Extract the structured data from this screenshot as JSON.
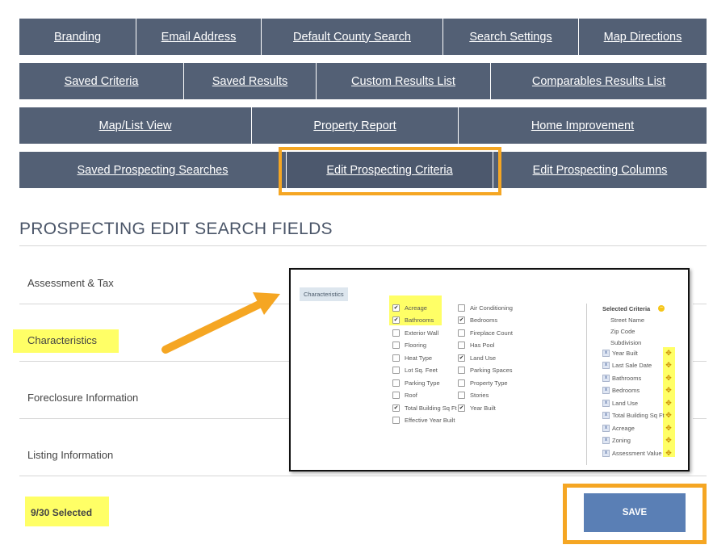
{
  "nav": {
    "row1": [
      "Branding",
      "Email Address",
      "Default County Search",
      "Search Settings",
      "Map Directions"
    ],
    "row2": [
      "Saved Criteria",
      "Saved Results",
      "Custom Results List",
      "Comparables Results List"
    ],
    "row3": [
      "Map/List View",
      "Property Report",
      "Home Improvement"
    ],
    "row4": [
      "Saved Prospecting Searches",
      "Edit Prospecting Criteria",
      "Edit Prospecting Columns"
    ]
  },
  "heading": "PROSPECTING EDIT SEARCH FIELDS",
  "categories": [
    "Assessment & Tax",
    "Characteristics",
    "Foreclosure Information",
    "Listing Information"
  ],
  "selected_count": "9/30 Selected",
  "save_label": "SAVE",
  "inset": {
    "tag": "Characteristics",
    "left_col": [
      {
        "label": "Acreage",
        "checked": true
      },
      {
        "label": "Bathrooms",
        "checked": true
      },
      {
        "label": "Exterior Wall",
        "checked": false
      },
      {
        "label": "Flooring",
        "checked": false
      },
      {
        "label": "Heat Type",
        "checked": false
      },
      {
        "label": "Lot Sq. Feet",
        "checked": false
      },
      {
        "label": "Parking Type",
        "checked": false
      },
      {
        "label": "Roof",
        "checked": false
      },
      {
        "label": "Total Building Sq Ft",
        "checked": true
      },
      {
        "label": "Effective Year Built",
        "checked": false
      }
    ],
    "right_col": [
      {
        "label": "Air Conditioning",
        "checked": false
      },
      {
        "label": "Bedrooms",
        "checked": true
      },
      {
        "label": "Fireplace Count",
        "checked": false
      },
      {
        "label": "Has Pool",
        "checked": false
      },
      {
        "label": "Land Use",
        "checked": true
      },
      {
        "label": "Parking Spaces",
        "checked": false
      },
      {
        "label": "Property Type",
        "checked": false
      },
      {
        "label": "Stories",
        "checked": false
      },
      {
        "label": "Year Built",
        "checked": true
      }
    ],
    "selected_title": "Selected Criteria",
    "fixed_items": [
      "Street Name",
      "Zip Code",
      "Subdivision"
    ],
    "removable_items": [
      "Year Built",
      "Last Sale Date",
      "Bathrooms",
      "Bedrooms",
      "Land Use",
      "Total Building Sq Ft",
      "Acreage",
      "Zoning",
      "Assessment Value"
    ]
  },
  "colors": {
    "nav_bg": "#536075",
    "highlight_orange": "#f5a623",
    "highlight_yellow": "#ffff66",
    "save_bg": "#5a7fb5"
  }
}
